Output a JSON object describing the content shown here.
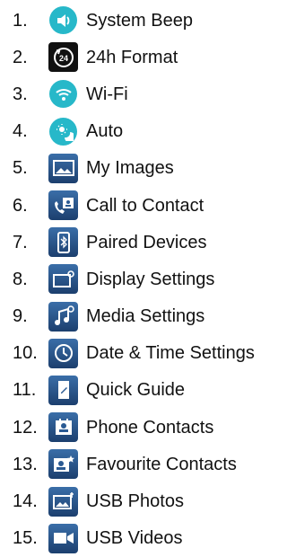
{
  "items": [
    {
      "number": "1.",
      "label": "System Beep",
      "icon": "speaker-icon"
    },
    {
      "number": "2.",
      "label": "24h Format",
      "icon": "clock-24h-icon"
    },
    {
      "number": "3.",
      "label": "Wi-Fi",
      "icon": "wifi-icon"
    },
    {
      "number": "4.",
      "label": "Auto",
      "icon": "auto-brightness-icon"
    },
    {
      "number": "5.",
      "label": "My Images",
      "icon": "images-icon"
    },
    {
      "number": "6.",
      "label": "Call to Contact",
      "icon": "call-contact-icon"
    },
    {
      "number": "7.",
      "label": "Paired Devices",
      "icon": "bluetooth-phone-icon"
    },
    {
      "number": "8.",
      "label": "Display Settings",
      "icon": "display-settings-icon"
    },
    {
      "number": "9.",
      "label": "Media Settings",
      "icon": "media-settings-icon"
    },
    {
      "number": "10.",
      "label": "Date & Time Settings",
      "icon": "clock-icon"
    },
    {
      "number": "11.",
      "label": "Quick Guide",
      "icon": "guide-icon"
    },
    {
      "number": "12.",
      "label": "Phone Contacts",
      "icon": "contacts-icon"
    },
    {
      "number": "13.",
      "label": "Favourite Contacts",
      "icon": "favourite-contacts-icon"
    },
    {
      "number": "14.",
      "label": "USB Photos",
      "icon": "usb-photos-icon"
    },
    {
      "number": "15.",
      "label": "USB Videos",
      "icon": "usb-videos-icon"
    }
  ],
  "colors": {
    "teal": "#27b8c9",
    "blue": "#2a5a93",
    "dark": "#111111"
  }
}
